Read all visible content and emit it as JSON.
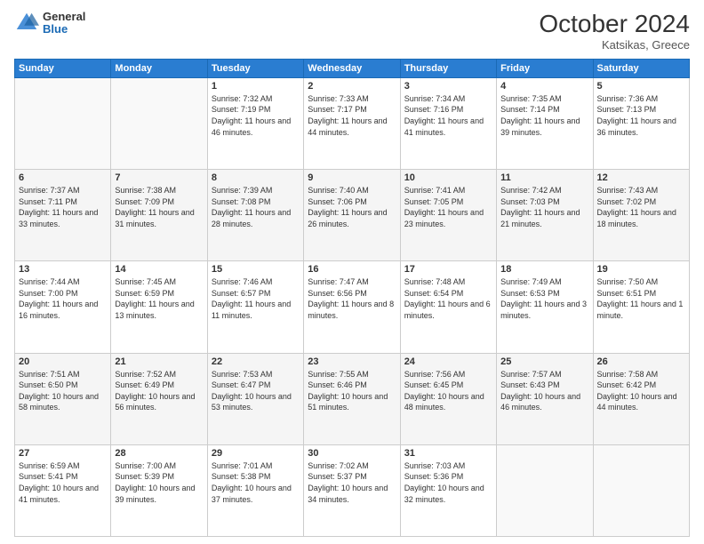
{
  "header": {
    "logo_general": "General",
    "logo_blue": "Blue",
    "month": "October 2024",
    "location": "Katsikas, Greece"
  },
  "weekdays": [
    "Sunday",
    "Monday",
    "Tuesday",
    "Wednesday",
    "Thursday",
    "Friday",
    "Saturday"
  ],
  "weeks": [
    [
      {
        "day": "",
        "sunrise": "",
        "sunset": "",
        "daylight": ""
      },
      {
        "day": "",
        "sunrise": "",
        "sunset": "",
        "daylight": ""
      },
      {
        "day": "1",
        "sunrise": "Sunrise: 7:32 AM",
        "sunset": "Sunset: 7:19 PM",
        "daylight": "Daylight: 11 hours and 46 minutes."
      },
      {
        "day": "2",
        "sunrise": "Sunrise: 7:33 AM",
        "sunset": "Sunset: 7:17 PM",
        "daylight": "Daylight: 11 hours and 44 minutes."
      },
      {
        "day": "3",
        "sunrise": "Sunrise: 7:34 AM",
        "sunset": "Sunset: 7:16 PM",
        "daylight": "Daylight: 11 hours and 41 minutes."
      },
      {
        "day": "4",
        "sunrise": "Sunrise: 7:35 AM",
        "sunset": "Sunset: 7:14 PM",
        "daylight": "Daylight: 11 hours and 39 minutes."
      },
      {
        "day": "5",
        "sunrise": "Sunrise: 7:36 AM",
        "sunset": "Sunset: 7:13 PM",
        "daylight": "Daylight: 11 hours and 36 minutes."
      }
    ],
    [
      {
        "day": "6",
        "sunrise": "Sunrise: 7:37 AM",
        "sunset": "Sunset: 7:11 PM",
        "daylight": "Daylight: 11 hours and 33 minutes."
      },
      {
        "day": "7",
        "sunrise": "Sunrise: 7:38 AM",
        "sunset": "Sunset: 7:09 PM",
        "daylight": "Daylight: 11 hours and 31 minutes."
      },
      {
        "day": "8",
        "sunrise": "Sunrise: 7:39 AM",
        "sunset": "Sunset: 7:08 PM",
        "daylight": "Daylight: 11 hours and 28 minutes."
      },
      {
        "day": "9",
        "sunrise": "Sunrise: 7:40 AM",
        "sunset": "Sunset: 7:06 PM",
        "daylight": "Daylight: 11 hours and 26 minutes."
      },
      {
        "day": "10",
        "sunrise": "Sunrise: 7:41 AM",
        "sunset": "Sunset: 7:05 PM",
        "daylight": "Daylight: 11 hours and 23 minutes."
      },
      {
        "day": "11",
        "sunrise": "Sunrise: 7:42 AM",
        "sunset": "Sunset: 7:03 PM",
        "daylight": "Daylight: 11 hours and 21 minutes."
      },
      {
        "day": "12",
        "sunrise": "Sunrise: 7:43 AM",
        "sunset": "Sunset: 7:02 PM",
        "daylight": "Daylight: 11 hours and 18 minutes."
      }
    ],
    [
      {
        "day": "13",
        "sunrise": "Sunrise: 7:44 AM",
        "sunset": "Sunset: 7:00 PM",
        "daylight": "Daylight: 11 hours and 16 minutes."
      },
      {
        "day": "14",
        "sunrise": "Sunrise: 7:45 AM",
        "sunset": "Sunset: 6:59 PM",
        "daylight": "Daylight: 11 hours and 13 minutes."
      },
      {
        "day": "15",
        "sunrise": "Sunrise: 7:46 AM",
        "sunset": "Sunset: 6:57 PM",
        "daylight": "Daylight: 11 hours and 11 minutes."
      },
      {
        "day": "16",
        "sunrise": "Sunrise: 7:47 AM",
        "sunset": "Sunset: 6:56 PM",
        "daylight": "Daylight: 11 hours and 8 minutes."
      },
      {
        "day": "17",
        "sunrise": "Sunrise: 7:48 AM",
        "sunset": "Sunset: 6:54 PM",
        "daylight": "Daylight: 11 hours and 6 minutes."
      },
      {
        "day": "18",
        "sunrise": "Sunrise: 7:49 AM",
        "sunset": "Sunset: 6:53 PM",
        "daylight": "Daylight: 11 hours and 3 minutes."
      },
      {
        "day": "19",
        "sunrise": "Sunrise: 7:50 AM",
        "sunset": "Sunset: 6:51 PM",
        "daylight": "Daylight: 11 hours and 1 minute."
      }
    ],
    [
      {
        "day": "20",
        "sunrise": "Sunrise: 7:51 AM",
        "sunset": "Sunset: 6:50 PM",
        "daylight": "Daylight: 10 hours and 58 minutes."
      },
      {
        "day": "21",
        "sunrise": "Sunrise: 7:52 AM",
        "sunset": "Sunset: 6:49 PM",
        "daylight": "Daylight: 10 hours and 56 minutes."
      },
      {
        "day": "22",
        "sunrise": "Sunrise: 7:53 AM",
        "sunset": "Sunset: 6:47 PM",
        "daylight": "Daylight: 10 hours and 53 minutes."
      },
      {
        "day": "23",
        "sunrise": "Sunrise: 7:55 AM",
        "sunset": "Sunset: 6:46 PM",
        "daylight": "Daylight: 10 hours and 51 minutes."
      },
      {
        "day": "24",
        "sunrise": "Sunrise: 7:56 AM",
        "sunset": "Sunset: 6:45 PM",
        "daylight": "Daylight: 10 hours and 48 minutes."
      },
      {
        "day": "25",
        "sunrise": "Sunrise: 7:57 AM",
        "sunset": "Sunset: 6:43 PM",
        "daylight": "Daylight: 10 hours and 46 minutes."
      },
      {
        "day": "26",
        "sunrise": "Sunrise: 7:58 AM",
        "sunset": "Sunset: 6:42 PM",
        "daylight": "Daylight: 10 hours and 44 minutes."
      }
    ],
    [
      {
        "day": "27",
        "sunrise": "Sunrise: 6:59 AM",
        "sunset": "Sunset: 5:41 PM",
        "daylight": "Daylight: 10 hours and 41 minutes."
      },
      {
        "day": "28",
        "sunrise": "Sunrise: 7:00 AM",
        "sunset": "Sunset: 5:39 PM",
        "daylight": "Daylight: 10 hours and 39 minutes."
      },
      {
        "day": "29",
        "sunrise": "Sunrise: 7:01 AM",
        "sunset": "Sunset: 5:38 PM",
        "daylight": "Daylight: 10 hours and 37 minutes."
      },
      {
        "day": "30",
        "sunrise": "Sunrise: 7:02 AM",
        "sunset": "Sunset: 5:37 PM",
        "daylight": "Daylight: 10 hours and 34 minutes."
      },
      {
        "day": "31",
        "sunrise": "Sunrise: 7:03 AM",
        "sunset": "Sunset: 5:36 PM",
        "daylight": "Daylight: 10 hours and 32 minutes."
      },
      {
        "day": "",
        "sunrise": "",
        "sunset": "",
        "daylight": ""
      },
      {
        "day": "",
        "sunrise": "",
        "sunset": "",
        "daylight": ""
      }
    ]
  ]
}
